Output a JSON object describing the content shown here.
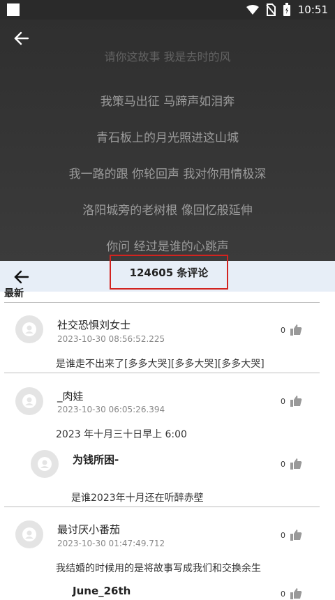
{
  "status": {
    "time": "10:51"
  },
  "lyrics": {
    "fade_top": "请你这故事 我是去时的风",
    "lines": [
      "我策马出征 马蹄声如泪奔",
      "青石板上的月光照进这山城",
      "我一路的跟 你轮回声 我对你用情极深",
      "洛阳城旁的老树根 像回忆般延伸",
      "你问 经过是谁的心跳声"
    ]
  },
  "comments_panel": {
    "count_label": "124605 条评论",
    "sort_label": "最新"
  },
  "comments": [
    {
      "user": "社交恐惧刘女士",
      "time": "2023-10-30 08:56:52.225",
      "likes": "0",
      "text": "是谁走不出来了[多多大哭][多多大哭][多多大哭]"
    },
    {
      "user": "_肉娃",
      "time": "2023-10-30 06:05:26.394",
      "likes": "0",
      "text": "2023 年十月三十日早上 6:00",
      "reply": {
        "user": "为钱所困-",
        "likes": "0",
        "text": "是谁2023年十月还在听醉赤壁"
      }
    },
    {
      "user": "最讨厌小番茄",
      "time": "2023-10-30 01:47:49.712",
      "likes": "0",
      "text": "我结婚的时候用的是将故事写成我们和交换余生",
      "reply": {
        "user": "June_26th",
        "likes": "0"
      }
    }
  ],
  "colors": {
    "highlight": "#d2231f",
    "header_bg": "#e7eef7"
  }
}
